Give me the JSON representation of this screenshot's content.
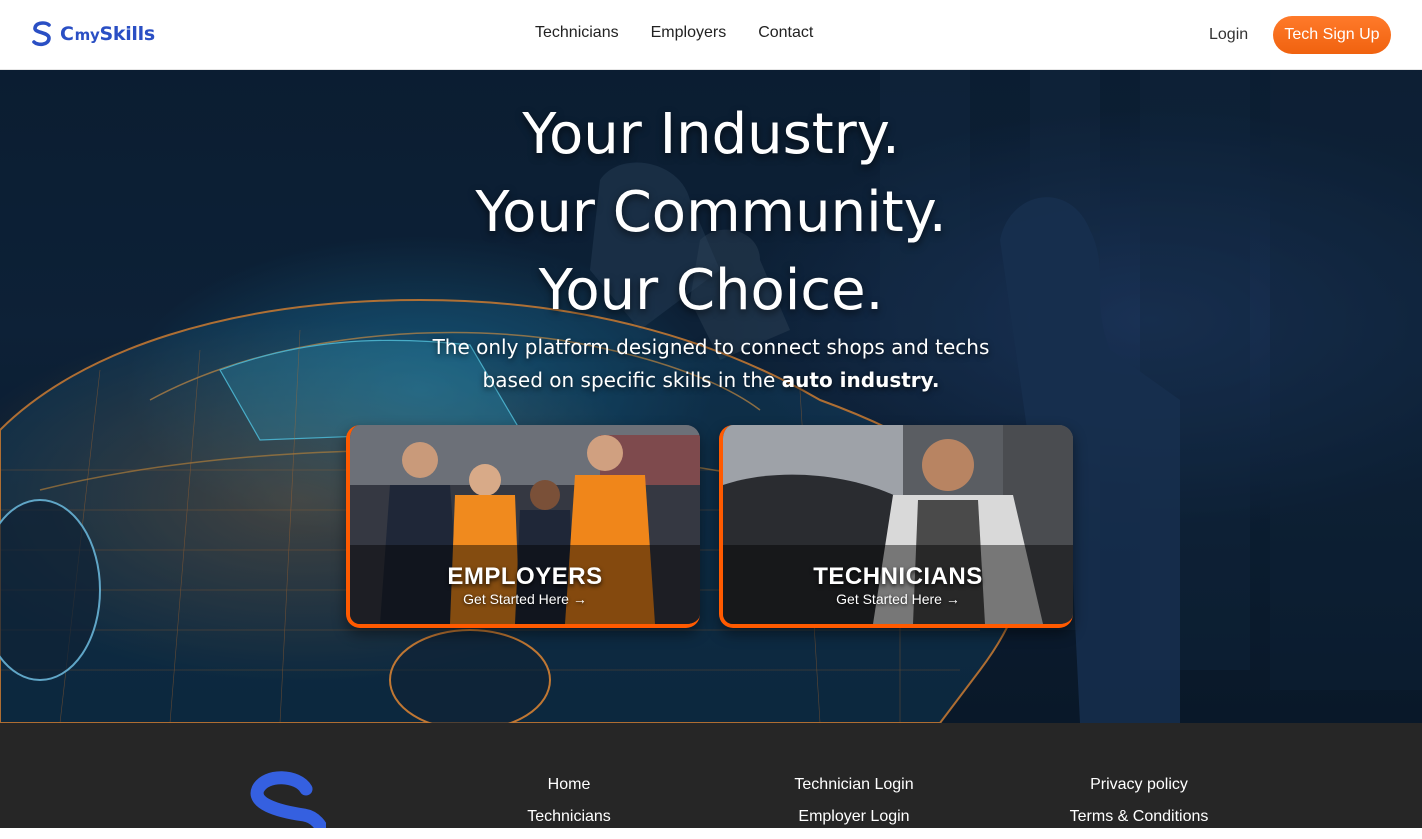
{
  "brand": {
    "name_prefix": "C",
    "name_mid": "my",
    "name_suffix": "Skills",
    "color": "#2a4fc4",
    "accent": "#f26a1b"
  },
  "nav": {
    "items": [
      "Technicians",
      "Employers",
      "Contact"
    ],
    "login": "Login",
    "signup": "Tech Sign Up"
  },
  "hero": {
    "line1": "Your Industry.",
    "line2": "Your Community.",
    "line3": "Your Choice.",
    "subtitle_line1": "The only platform designed to connect shops and techs",
    "subtitle_line2_pre": "based on specific skills in the ",
    "subtitle_line2_bold": "auto industry."
  },
  "cards": [
    {
      "title": "EMPLOYERS",
      "link": "Get Started Here →"
    },
    {
      "title": "TECHNICIANS",
      "link": "Get Started Here →"
    }
  ],
  "footer": {
    "col1": [
      "Home",
      "Technicians"
    ],
    "col2": [
      "Technician Login",
      "Employer Login"
    ],
    "col3": [
      "Privacy policy",
      "Terms & Conditions"
    ]
  }
}
